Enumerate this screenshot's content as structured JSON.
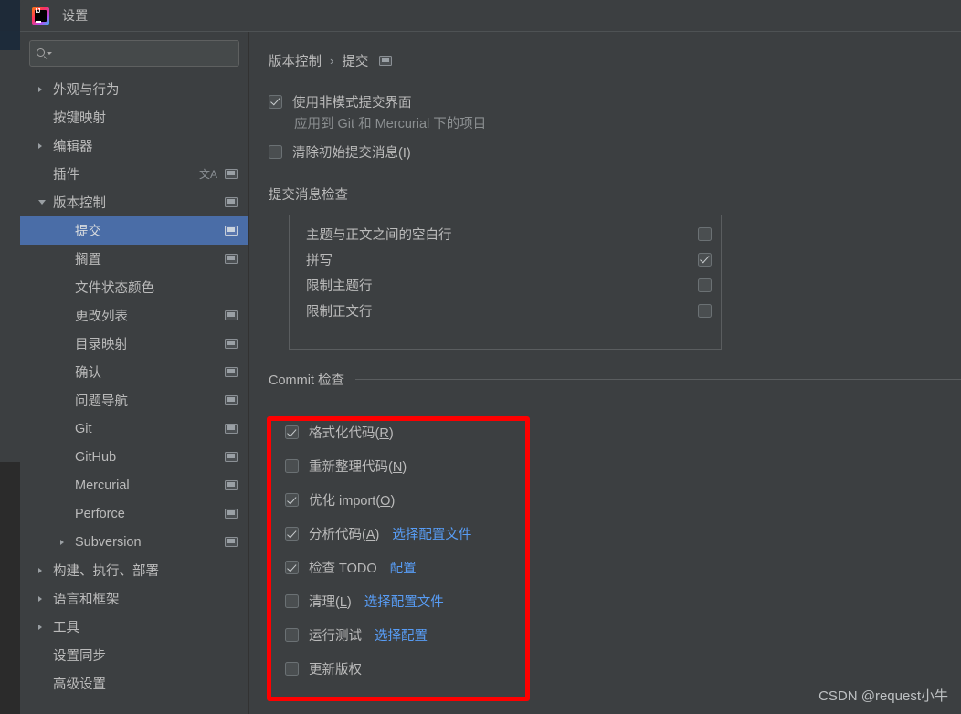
{
  "window": {
    "title": "设置",
    "app_icon": "intellij-idea-icon",
    "icon_text": "IJ"
  },
  "sidebar": {
    "search": {
      "placeholder": "",
      "value": "",
      "icon": "search-icon"
    },
    "items": [
      {
        "label": "外观与行为",
        "level": 0,
        "arrow": "collapsed",
        "config_icon": false,
        "lang_icon": false,
        "selected": false
      },
      {
        "label": "按键映射",
        "level": 0,
        "arrow": "none",
        "config_icon": false,
        "lang_icon": false,
        "selected": false
      },
      {
        "label": "编辑器",
        "level": 0,
        "arrow": "collapsed",
        "config_icon": false,
        "lang_icon": false,
        "selected": false
      },
      {
        "label": "插件",
        "level": 0,
        "arrow": "none",
        "config_icon": true,
        "lang_icon": true,
        "selected": false
      },
      {
        "label": "版本控制",
        "level": 0,
        "arrow": "expanded",
        "config_icon": true,
        "lang_icon": false,
        "selected": false
      },
      {
        "label": "提交",
        "level": 1,
        "arrow": "none",
        "config_icon": true,
        "lang_icon": false,
        "selected": true
      },
      {
        "label": "搁置",
        "level": 1,
        "arrow": "none",
        "config_icon": true,
        "lang_icon": false,
        "selected": false
      },
      {
        "label": "文件状态颜色",
        "level": 1,
        "arrow": "none",
        "config_icon": false,
        "lang_icon": false,
        "selected": false
      },
      {
        "label": "更改列表",
        "level": 1,
        "arrow": "none",
        "config_icon": true,
        "lang_icon": false,
        "selected": false
      },
      {
        "label": "目录映射",
        "level": 1,
        "arrow": "none",
        "config_icon": true,
        "lang_icon": false,
        "selected": false
      },
      {
        "label": "确认",
        "level": 1,
        "arrow": "none",
        "config_icon": true,
        "lang_icon": false,
        "selected": false
      },
      {
        "label": "问题导航",
        "level": 1,
        "arrow": "none",
        "config_icon": true,
        "lang_icon": false,
        "selected": false
      },
      {
        "label": "Git",
        "level": 1,
        "arrow": "none",
        "config_icon": true,
        "lang_icon": false,
        "selected": false
      },
      {
        "label": "GitHub",
        "level": 1,
        "arrow": "none",
        "config_icon": true,
        "lang_icon": false,
        "selected": false
      },
      {
        "label": "Mercurial",
        "level": 1,
        "arrow": "none",
        "config_icon": true,
        "lang_icon": false,
        "selected": false
      },
      {
        "label": "Perforce",
        "level": 1,
        "arrow": "none",
        "config_icon": true,
        "lang_icon": false,
        "selected": false
      },
      {
        "label": "Subversion",
        "level": 1,
        "arrow": "collapsed",
        "config_icon": true,
        "lang_icon": false,
        "selected": false
      },
      {
        "label": "构建、执行、部署",
        "level": 0,
        "arrow": "collapsed",
        "config_icon": false,
        "lang_icon": false,
        "selected": false
      },
      {
        "label": "语言和框架",
        "level": 0,
        "arrow": "collapsed",
        "config_icon": false,
        "lang_icon": false,
        "selected": false
      },
      {
        "label": "工具",
        "level": 0,
        "arrow": "collapsed",
        "config_icon": false,
        "lang_icon": false,
        "selected": false
      },
      {
        "label": "设置同步",
        "level": 0,
        "arrow": "none",
        "config_icon": false,
        "lang_icon": false,
        "selected": false
      },
      {
        "label": "高级设置",
        "level": 0,
        "arrow": "none",
        "config_icon": false,
        "lang_icon": false,
        "selected": false
      }
    ]
  },
  "content": {
    "breadcrumb": {
      "parent": "版本控制",
      "separator": "›",
      "current": "提交",
      "config_icon": "project-scope-icon"
    },
    "top_options": [
      {
        "label": "使用非模式提交界面",
        "checked": true
      },
      {
        "label": "清除初始提交消息(I)",
        "checked": false
      }
    ],
    "sub_note": "应用到 Git 和 Mercurial 下的项目",
    "message_checks": {
      "section_title": "提交消息检查",
      "rows": [
        {
          "label": "主题与正文之间的空白行",
          "checked": false
        },
        {
          "label": "拼写",
          "checked": true
        },
        {
          "label": "限制主题行",
          "checked": false
        },
        {
          "label": "限制正文行",
          "checked": false
        }
      ]
    },
    "commit_checks": {
      "section_title": "Commit 检查",
      "rows": [
        {
          "label": "格式化代码(R)",
          "mnemonic": "R",
          "checked": true,
          "link": ""
        },
        {
          "label": "重新整理代码(N)",
          "mnemonic": "N",
          "checked": false,
          "link": ""
        },
        {
          "label": "优化 import(O)",
          "mnemonic": "O",
          "checked": true,
          "link": ""
        },
        {
          "label": "分析代码(A)",
          "mnemonic": "A",
          "checked": true,
          "link": "选择配置文件"
        },
        {
          "label": "检查 TODO",
          "mnemonic": "",
          "checked": true,
          "link": "配置"
        },
        {
          "label": "清理(L)",
          "mnemonic": "L",
          "checked": false,
          "link": "选择配置文件"
        },
        {
          "label": "运行测试",
          "mnemonic": "",
          "checked": false,
          "link": "选择配置"
        },
        {
          "label": "更新版权",
          "mnemonic": "",
          "checked": false,
          "link": ""
        }
      ],
      "highlight_color": "#fe0000"
    }
  },
  "watermark": {
    "text": "CSDN @request小牛"
  },
  "colors": {
    "window_bg": "#3c3f41",
    "selection_blue": "#4a6da7",
    "link_blue": "#589df6",
    "text": "#bbbbbb",
    "muted_text": "#8b8f91",
    "highlight_red": "#fe0000"
  }
}
